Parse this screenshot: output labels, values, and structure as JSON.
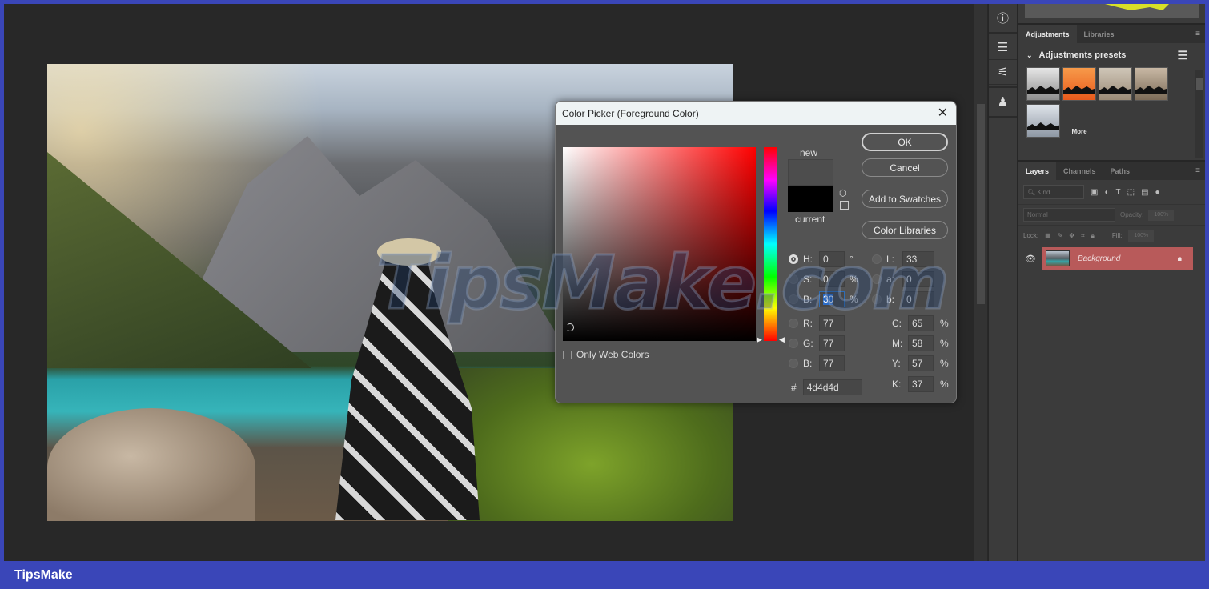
{
  "dialog": {
    "title": "Color Picker (Foreground Color)",
    "close_icon": "close-icon",
    "buttons": {
      "ok": "OK",
      "cancel": "Cancel",
      "add_swatches": "Add to Swatches",
      "color_libraries": "Color Libraries"
    },
    "swatch": {
      "new_label": "new",
      "current_label": "current",
      "new_color": "#4d4d4d",
      "current_color": "#000000"
    },
    "only_web_colors": {
      "label": "Only Web Colors",
      "checked": false
    },
    "hue_selected": "H",
    "fields": {
      "H": {
        "label": "H:",
        "value": "0",
        "unit": "°"
      },
      "S": {
        "label": "S:",
        "value": "0",
        "unit": "%"
      },
      "B": {
        "label": "B:",
        "value": "30",
        "unit": "%"
      },
      "R": {
        "label": "R:",
        "value": "77"
      },
      "G": {
        "label": "G:",
        "value": "77"
      },
      "Bl": {
        "label": "B:",
        "value": "77"
      },
      "L": {
        "label": "L:",
        "value": "33"
      },
      "a": {
        "label": "a:",
        "value": "0"
      },
      "b": {
        "label": "b:",
        "value": "0"
      },
      "C": {
        "label": "C:",
        "value": "65",
        "unit": "%"
      },
      "M": {
        "label": "M:",
        "value": "58",
        "unit": "%"
      },
      "Y": {
        "label": "Y:",
        "value": "57",
        "unit": "%"
      },
      "K": {
        "label": "K:",
        "value": "37",
        "unit": "%"
      }
    },
    "hex": {
      "label": "#",
      "value": "4d4d4d"
    }
  },
  "tool_strip": {
    "icons": [
      "info-icon",
      "brush-presets-icon",
      "brush-settings-icon",
      "clone-source-icon"
    ]
  },
  "adjustments_panel": {
    "tabs": [
      "Adjustments",
      "Libraries"
    ],
    "active_tab": "Adjustments",
    "section_title": "Adjustments presets",
    "more_label": "More"
  },
  "layers_panel": {
    "tabs": [
      "Layers",
      "Channels",
      "Paths"
    ],
    "active_tab": "Layers",
    "filter_placeholder": "Kind",
    "blend_mode": "Normal",
    "opacity_label": "Opacity:",
    "opacity_value": "100%",
    "lock_label": "Lock:",
    "fill_label": "Fill:",
    "fill_value": "100%",
    "layers": [
      {
        "name": "Background",
        "visible": true,
        "locked": true,
        "selected": true
      }
    ]
  },
  "watermark": "TipsMake.com",
  "footer": {
    "brand": "TipsMake"
  }
}
